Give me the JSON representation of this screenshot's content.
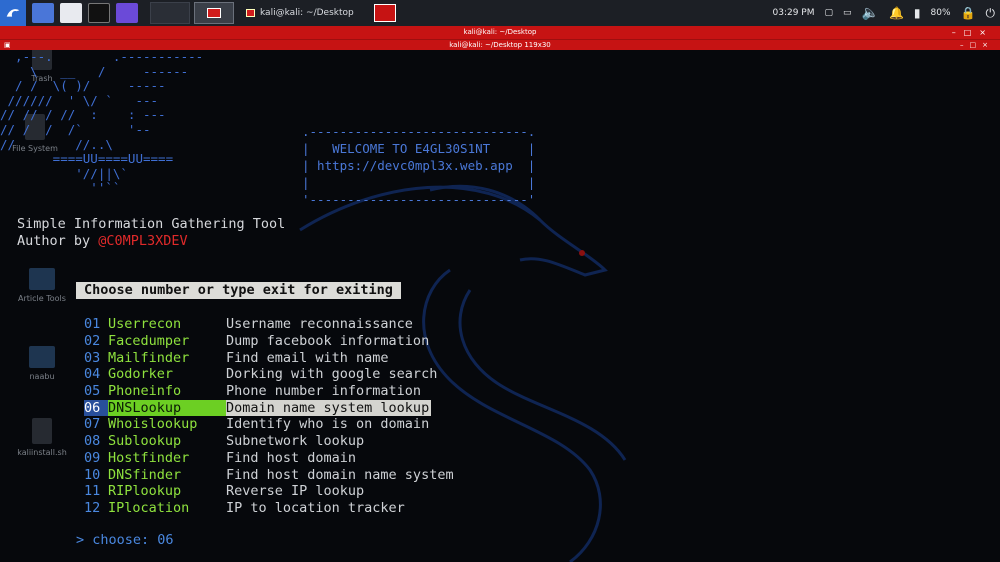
{
  "panel": {
    "task_label": "kali@kali: ~/Desktop",
    "time": "03:29 PM",
    "battery": "80%"
  },
  "window": {
    "title": "kali@kali: ~/Desktop",
    "terminal_title": "kali@kali: ~/Desktop 119x30"
  },
  "desktop_icons": [
    "Trash",
    "File System",
    "Article Tools",
    "naabu",
    "kaliinstall.sh"
  ],
  "banner": {
    "ascii_lines": [
      "  ,---.        .-----------",
      "    \\   __   /     ------",
      "  / /  \\( )/     -----",
      " //////  ' \\/ `   ---",
      "// // / //  :    : ---",
      "// /  /  /`      '--",
      "//        //..\\",
      "       ====UU====UU====",
      "          '//||\\`",
      "            ''``"
    ],
    "box_top": ".-----------------------------.",
    "box_line1": "|   WELCOME TO E4GL30S1NT     |",
    "box_line2": "| https://devc0mpl3x.web.app  |",
    "box_line3": "|                             |",
    "box_bottom": "'-----------------------------'"
  },
  "info": {
    "tool_line": "Simple Information Gathering Tool",
    "author_prefix": "Author by ",
    "author_handle": "@C0MPL3XDEV"
  },
  "menu_header": "Choose number or type exit for exiting",
  "menu": [
    {
      "num": "01",
      "name": "Userrecon",
      "desc": "Username reconnaissance"
    },
    {
      "num": "02",
      "name": "Facedumper",
      "desc": "Dump facebook information"
    },
    {
      "num": "03",
      "name": "Mailfinder",
      "desc": "Find email with name"
    },
    {
      "num": "04",
      "name": "Godorker",
      "desc": "Dorking with google search"
    },
    {
      "num": "05",
      "name": "Phoneinfo",
      "desc": "Phone number information"
    },
    {
      "num": "06",
      "name": "DNSLookup",
      "desc": "Domain name system lookup"
    },
    {
      "num": "07",
      "name": "Whoislookup",
      "desc": "Identify who is on domain"
    },
    {
      "num": "08",
      "name": "Sublookup",
      "desc": "Subnetwork lookup"
    },
    {
      "num": "09",
      "name": "Hostfinder",
      "desc": "Find host domain"
    },
    {
      "num": "10",
      "name": "DNSfinder",
      "desc": "Find host domain name system"
    },
    {
      "num": "11",
      "name": "RIPlookup",
      "desc": "Reverse IP lookup"
    },
    {
      "num": "12",
      "name": "IPlocation",
      "desc": "IP to location tracker"
    }
  ],
  "selected_index": 5,
  "prompt": {
    "label": "> choose: ",
    "value": "06"
  },
  "colors": {
    "panel_bg": "#1c1f25",
    "title_red": "#c61313",
    "terminal_bg": "#06080c",
    "number_blue": "#4a88e0",
    "tool_green": "#8fe23e",
    "author_red": "#e02a2a"
  }
}
